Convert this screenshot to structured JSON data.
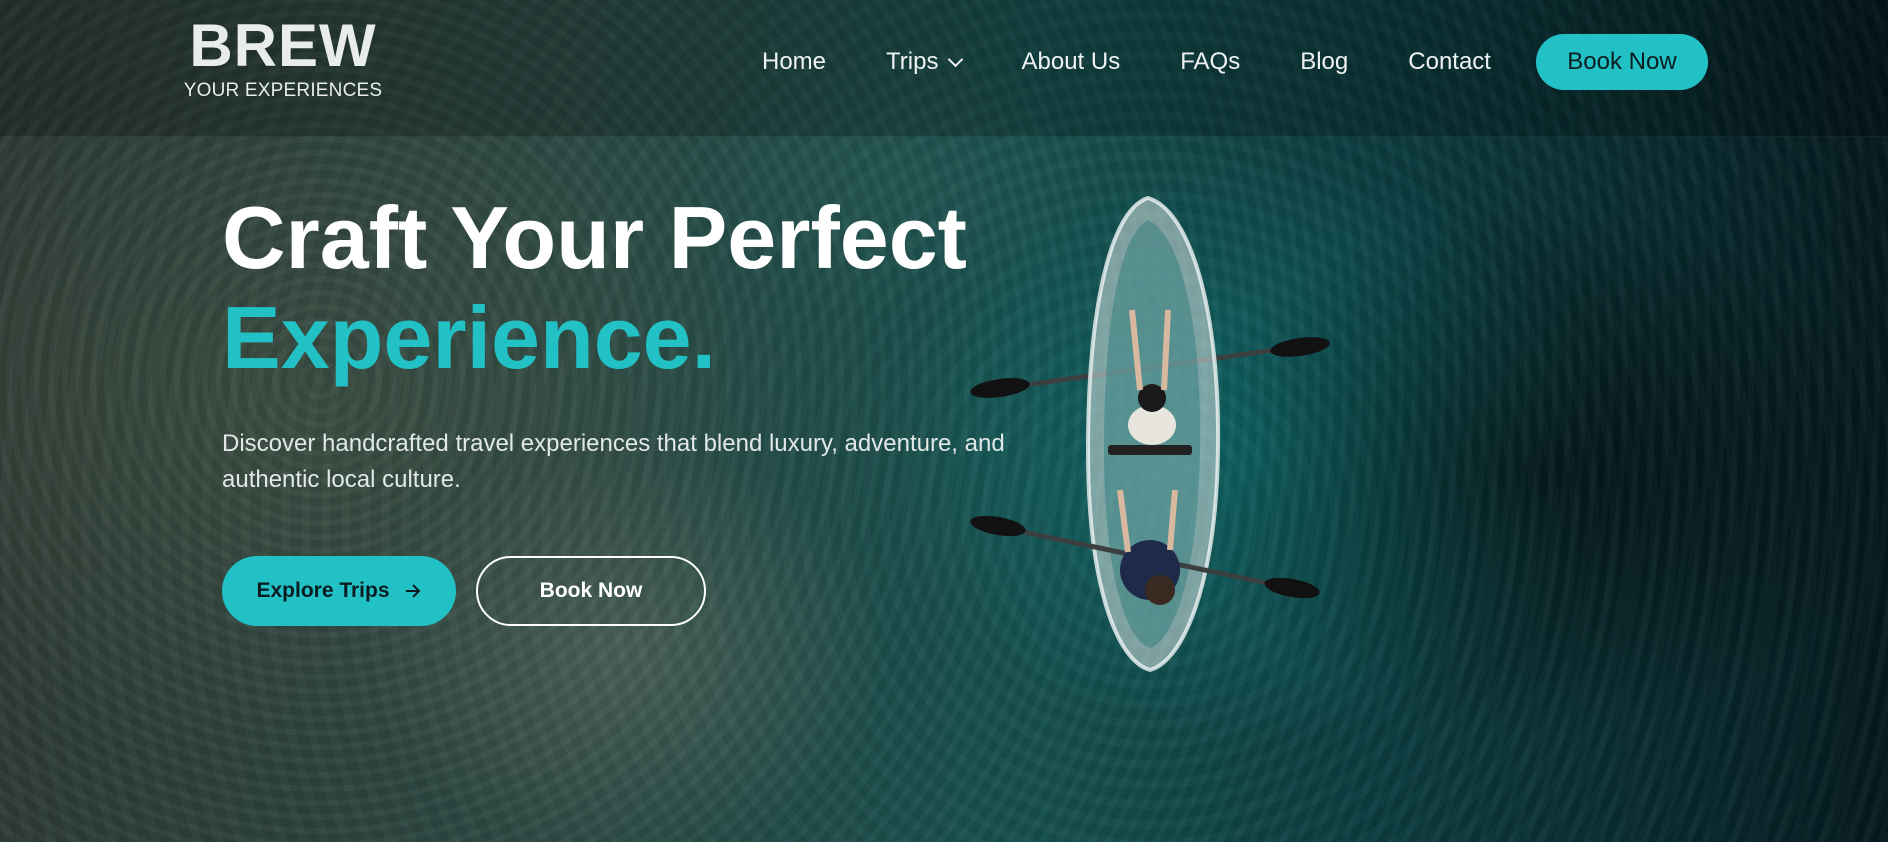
{
  "header": {
    "logo": {
      "title": "BREW",
      "tagline": "YOUR EXPERIENCES"
    },
    "nav": {
      "items": [
        {
          "label": "Home"
        },
        {
          "label": "Trips",
          "icon": "chevron-down-icon"
        },
        {
          "label": "About Us"
        },
        {
          "label": "FAQs"
        },
        {
          "label": "Blog"
        },
        {
          "label": "Contact"
        }
      ],
      "cta_label": "Book Now"
    }
  },
  "hero": {
    "headline_line1": "Craft Your Perfect",
    "headline_line2": "Experience.",
    "subtext": "Discover handcrafted travel experiences that blend luxury, adventure, and authentic local culture.",
    "primary_button": {
      "label": "Explore Trips",
      "icon": "arrow-right-icon"
    },
    "secondary_button": {
      "label": "Book Now"
    },
    "background_image": "aerial-kayak-on-turquoise-water"
  },
  "colors": {
    "accent": "#22c1c6",
    "text_light": "#ffffff",
    "button_text_dark": "#0b1d21"
  }
}
